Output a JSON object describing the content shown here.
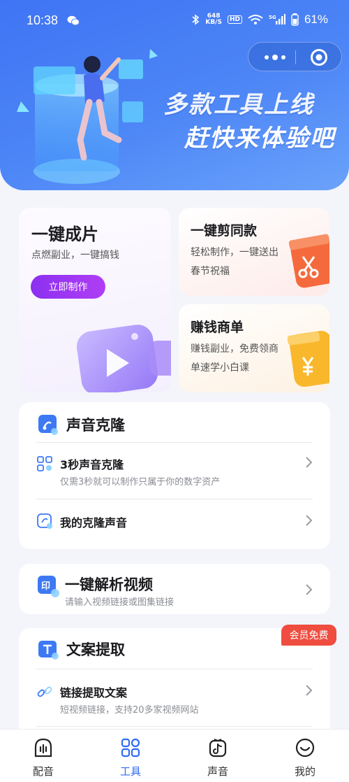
{
  "status_bar": {
    "time": "10:38",
    "net_speed_value": "648",
    "net_speed_unit": "KB/S",
    "hd": "HD",
    "battery": "61%"
  },
  "hero": {
    "title_line1": "多款工具上线",
    "title_line2": "赶快来体验吧"
  },
  "cards": {
    "one_click_film": {
      "title": "一键成片",
      "subtitle": "点燃副业，一键搞钱",
      "button": "立即制作"
    },
    "same_edit": {
      "title": "一键剪同款",
      "subtitle": "轻松制作，一键送出春节祝福"
    },
    "earn_orders": {
      "title": "赚钱商单",
      "subtitle": "赚钱副业，免费领商单速学小白课"
    }
  },
  "voice_clone": {
    "title": "声音克隆",
    "items": [
      {
        "title": "3秒声音克隆",
        "subtitle": "仅需3秒就可以制作只属于你的数字资产"
      },
      {
        "title": "我的克隆声音"
      }
    ]
  },
  "parse_video": {
    "title": "一键解析视频",
    "subtitle": "请输入视频链接或图集链接"
  },
  "copy_extract": {
    "badge": "会员免费",
    "title": "文案提取",
    "items": [
      {
        "title": "链接提取文案",
        "subtitle": "短视频链接，支持20多家视频网站"
      }
    ]
  },
  "tabbar": {
    "active": "工具",
    "tabs": [
      {
        "label": "配音",
        "icon": "soundwave-icon"
      },
      {
        "label": "工具",
        "icon": "grid-icon"
      },
      {
        "label": "声音",
        "icon": "tiktok-icon"
      },
      {
        "label": "我的",
        "icon": "smile-icon"
      }
    ]
  },
  "colors": {
    "primary": "#2f6bf2",
    "hero_bg": "#4d86f6",
    "button_purple": "#8b30f0",
    "vip_red": "#ef4d3f"
  }
}
